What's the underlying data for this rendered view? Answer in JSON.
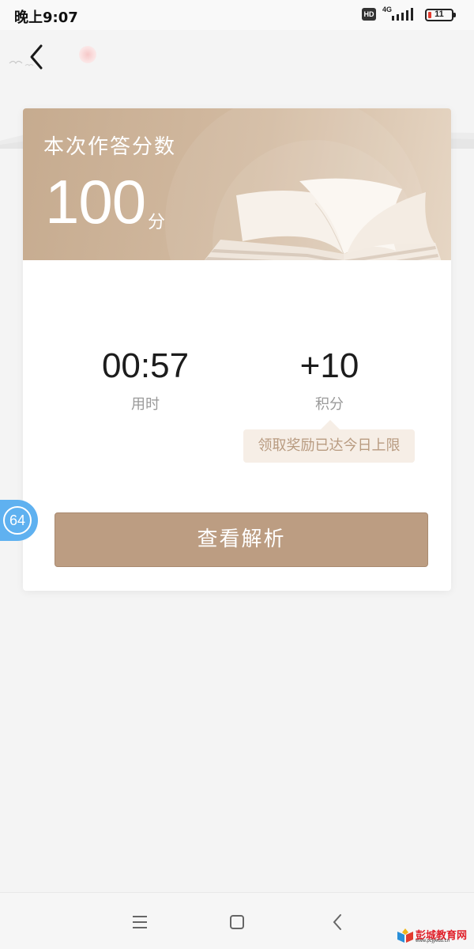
{
  "status_bar": {
    "time": "晚上9:07",
    "hd": "HD",
    "network": "4G",
    "battery": "11"
  },
  "card": {
    "title": "本次作答分数",
    "score": "100",
    "score_unit": "分",
    "stats": [
      {
        "value": "00:57",
        "label": "用时"
      },
      {
        "value": "+10",
        "label": "积分"
      }
    ],
    "limit_tip": "领取奖励已达今日上限",
    "analysis_button": "查看解析"
  },
  "float_badge": {
    "value": "64"
  },
  "watermark": {
    "text": "彭城教育网",
    "sub": "www.pcjyedu.cn"
  },
  "colors": {
    "accent": "#bc9d82",
    "banner": "#c6ab8f",
    "tip_text": "#b89b80",
    "badge": "#5fb1f0"
  },
  "icons": [
    "back-arrow-icon",
    "signal-icon",
    "battery-icon",
    "menu-icon",
    "home-icon",
    "nav-back-icon",
    "book-icon"
  ]
}
